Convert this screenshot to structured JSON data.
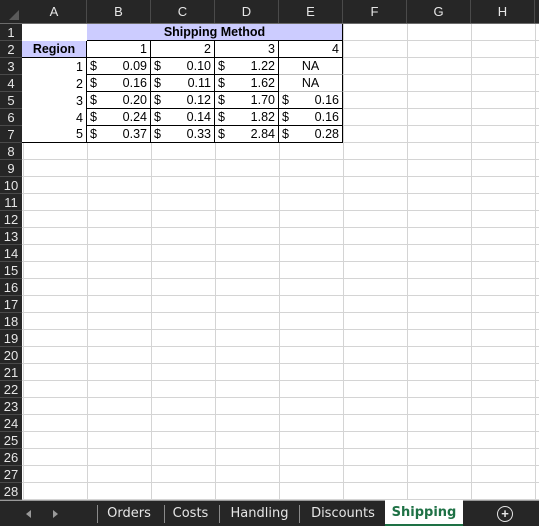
{
  "columns": [
    "A",
    "B",
    "C",
    "D",
    "E",
    "F",
    "G",
    "H"
  ],
  "rows": [
    "1",
    "2",
    "3",
    "4",
    "5",
    "6",
    "7",
    "8",
    "9",
    "10",
    "11",
    "12",
    "13",
    "14",
    "15",
    "16",
    "17",
    "18",
    "19",
    "20",
    "21",
    "22",
    "23",
    "24",
    "25",
    "26",
    "27",
    "28"
  ],
  "table": {
    "title": "Shipping Method",
    "row_label": "Region",
    "methods": [
      "1",
      "2",
      "3",
      "4"
    ],
    "currency": "$",
    "body": [
      {
        "region": "1",
        "values": [
          "0.09",
          "0.10",
          "1.22",
          "NA"
        ]
      },
      {
        "region": "2",
        "values": [
          "0.16",
          "0.11",
          "1.62",
          "NA"
        ]
      },
      {
        "region": "3",
        "values": [
          "0.20",
          "0.12",
          "1.70",
          "0.16"
        ]
      },
      {
        "region": "4",
        "values": [
          "0.24",
          "0.14",
          "1.82",
          "0.16"
        ]
      },
      {
        "region": "5",
        "values": [
          "0.37",
          "0.33",
          "2.84",
          "0.28"
        ]
      }
    ]
  },
  "sheet_tabs": [
    {
      "label": "Orders",
      "active": false
    },
    {
      "label": "Costs",
      "active": false
    },
    {
      "label": "Handling",
      "active": false
    },
    {
      "label": "Discounts",
      "active": false
    },
    {
      "label": "Shipping",
      "active": true
    }
  ],
  "nav": {
    "prev_icon": "triangle-left",
    "next_icon": "triangle-right",
    "add_icon": "plus-circle"
  },
  "colors": {
    "header_fill": "#ccccff",
    "active_tab_text": "#1e7145",
    "chrome_bg": "#262626"
  }
}
